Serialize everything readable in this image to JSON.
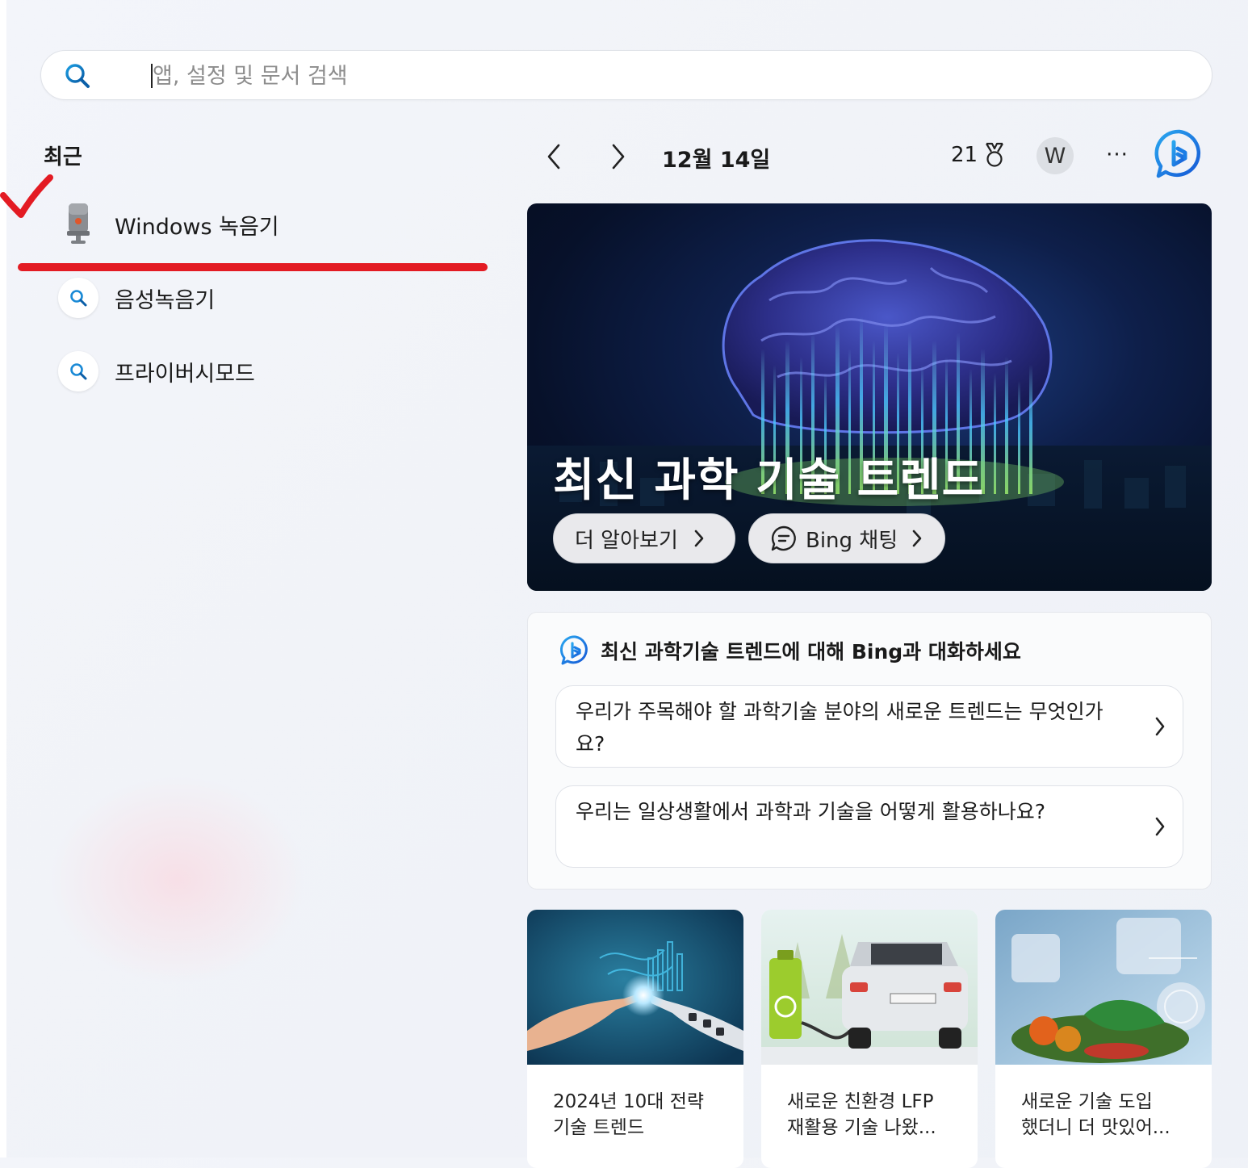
{
  "search": {
    "placeholder": "앱, 설정 및 문서 검색"
  },
  "recent": {
    "title": "최근",
    "items": [
      {
        "label": "Windows 녹음기",
        "icon": "microphone-icon"
      },
      {
        "label": "음성녹음기",
        "icon": "search-icon"
      },
      {
        "label": "프라이버시모드",
        "icon": "search-icon"
      }
    ]
  },
  "header": {
    "date": "12월 14일",
    "points": "21",
    "avatar_letter": "W",
    "more": "···"
  },
  "hero": {
    "title": "최신 과학 기술 트렌드",
    "learn_more": "더 알아보기",
    "bing_chat": "Bing 채팅"
  },
  "chat": {
    "title": "최신 과학기술 트렌드에 대해 Bing과 대화하세요",
    "questions": [
      "우리가 주목해야 할 과학기술 분야의 새로운 트렌드는 무엇인가요?",
      "우리는 일상생활에서 과학과 기술을 어떻게 활용하나요?"
    ]
  },
  "news": [
    {
      "title": "2024년 10대 전략\n기술 트렌드"
    },
    {
      "title": "새로운 친환경 LFP\n재활용 기술 나왔..."
    },
    {
      "title": "새로운 기술 도입\n했더니 더 맛있어..."
    }
  ],
  "colors": {
    "accent": "#0067c0",
    "annotation_red": "#e31b23",
    "bing_blue": "#1e7be0"
  }
}
